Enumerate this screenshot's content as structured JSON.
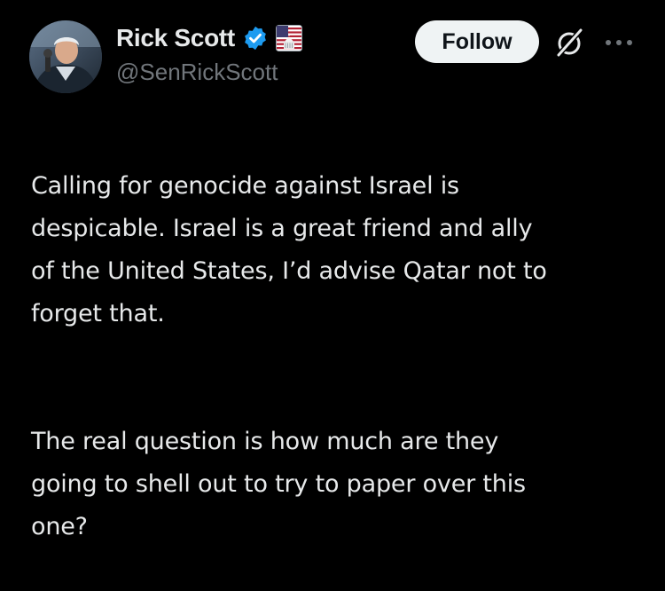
{
  "author": {
    "name": "Rick Scott",
    "handle": "@SenRickScott",
    "verified_badge_color": "#1d9bf0",
    "affiliation_badge": "us-capitol-flag-icon"
  },
  "actions": {
    "follow_label": "Follow",
    "grok_icon": "grok-icon",
    "more_icon": "more-options-icon"
  },
  "tweet": {
    "paragraph_1": "Calling for genocide against Israel is\ndespicable. Israel is a great friend and ally\nof the United States, I’d advise Qatar not to\nforget that.",
    "paragraph_2": "The real question is how much are they\ngoing to shell out to try to paper over this\none?"
  },
  "colors": {
    "background": "#000000",
    "text_primary": "#e7e9ea",
    "text_secondary": "#71767b",
    "follow_bg": "#eff3f4",
    "follow_text": "#0f1419"
  }
}
